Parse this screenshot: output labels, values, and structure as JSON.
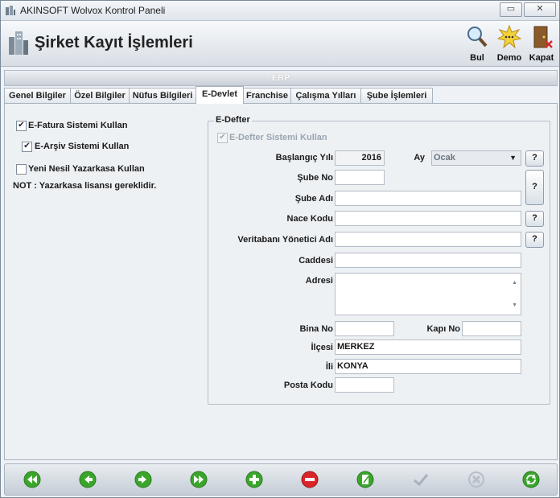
{
  "window": {
    "title": "AKINSOFT Wolvox Kontrol Paneli",
    "minimize_glyph": "▭",
    "close_glyph": "✕"
  },
  "header": {
    "title": "Şirket Kayıt İşlemleri",
    "buttons": [
      {
        "label": "Bul",
        "icon": "magnifier-icon"
      },
      {
        "label": "Demo",
        "icon": "starburst-icon"
      },
      {
        "label": "Kapat",
        "icon": "door-exit-icon"
      }
    ]
  },
  "section_bar": "ERP",
  "tabs": [
    {
      "label": "Genel Bilgiler"
    },
    {
      "label": "Özel Bilgiler"
    },
    {
      "label": "Nüfus Bilgileri"
    },
    {
      "label": "E-Devlet"
    },
    {
      "label": "Franchise"
    },
    {
      "label": "Çalışma Yılları"
    },
    {
      "label": "Şube İşlemleri"
    }
  ],
  "active_tab": "E-Devlet",
  "left": {
    "efatura": {
      "label": "E-Fatura Sistemi Kullan",
      "checked": true
    },
    "earsiv": {
      "label": "E-Arşiv Sistemi Kullan",
      "checked": true
    },
    "yazarkasa": {
      "label": "Yeni Nesil Yazarkasa Kullan",
      "checked": false
    },
    "note": "NOT : Yazarkasa lisansı gereklidir."
  },
  "edefter": {
    "group_title": "E-Defter",
    "use_label": "E-Defter Sistemi Kullan",
    "use_checked": true,
    "labels": {
      "baslangic_yili": "Başlangıç Yılı",
      "ay": "Ay",
      "sube_no": "Şube No",
      "sube_adi": "Şube Adı",
      "nace_kodu": "Nace Kodu",
      "veritabani": "Veritabanı Yönetici Adı",
      "caddesi": "Caddesi",
      "adresi": "Adresi",
      "bina_no": "Bina No",
      "kapi_no": "Kapı No",
      "ilcesi": "İlçesi",
      "ili": "İli",
      "posta_kodu": "Posta Kodu"
    },
    "values": {
      "baslangic_yili": "2016",
      "ay": "Ocak",
      "sube_no": "",
      "sube_adi": "",
      "nace_kodu": "",
      "veritabani": "",
      "caddesi": "",
      "adresi": "",
      "bina_no": "",
      "kapi_no": "",
      "ilcesi": "MERKEZ",
      "ili": "KONYA",
      "posta_kodu": ""
    },
    "help_glyph": "?"
  },
  "bottom_nav": [
    {
      "name": "first-record-button",
      "icon": "first-icon",
      "color": "#3aa52b",
      "enabled": true
    },
    {
      "name": "previous-record-button",
      "icon": "previous-icon",
      "color": "#3aa52b",
      "enabled": true
    },
    {
      "name": "next-record-button",
      "icon": "next-icon",
      "color": "#3aa52b",
      "enabled": true
    },
    {
      "name": "last-record-button",
      "icon": "last-icon",
      "color": "#3aa52b",
      "enabled": true
    },
    {
      "name": "add-record-button",
      "icon": "plus-icon",
      "color": "#3aa52b",
      "enabled": true
    },
    {
      "name": "delete-record-button",
      "icon": "minus-icon",
      "color": "#d8262b",
      "enabled": true
    },
    {
      "name": "edit-record-button",
      "icon": "edit-icon",
      "color": "#3aa52b",
      "enabled": true
    },
    {
      "name": "save-record-button",
      "icon": "check-icon",
      "color": "#a9b2bb",
      "enabled": false
    },
    {
      "name": "cancel-record-button",
      "icon": "cancel-icon",
      "color": "#a9b2bb",
      "enabled": false
    },
    {
      "name": "refresh-button",
      "icon": "refresh-icon",
      "color": "#3aa52b",
      "enabled": true
    }
  ]
}
